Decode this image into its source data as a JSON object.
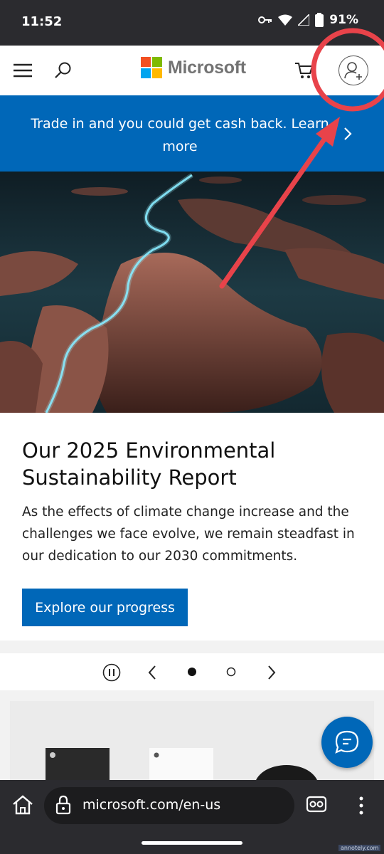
{
  "status_bar": {
    "time": "11:52",
    "battery": "91%"
  },
  "header": {
    "logo_text": "Microsoft",
    "logo_colors": [
      "#f25022",
      "#7fba00",
      "#00a4ef",
      "#ffb900"
    ],
    "icons": [
      "menu-icon",
      "search-icon",
      "cart-icon",
      "account-add-icon"
    ]
  },
  "promo": {
    "text": "Trade in and you could get cash back. Learn more",
    "color": "#0067b8"
  },
  "feature": {
    "title": "Our 2025 Environmental Sustainability Report",
    "body": "As the effects of climate change increase and the challenges we face evolve, we remain steadfast in our dedication to our 2030 commitments.",
    "cta": "Explore our progress"
  },
  "carousel": {
    "slide_count": 2,
    "active_slide": 1
  },
  "browser": {
    "url": "microsoft.com/en-us"
  },
  "annotation": {
    "color": "#e8434a",
    "watermark": "annotely.com"
  }
}
